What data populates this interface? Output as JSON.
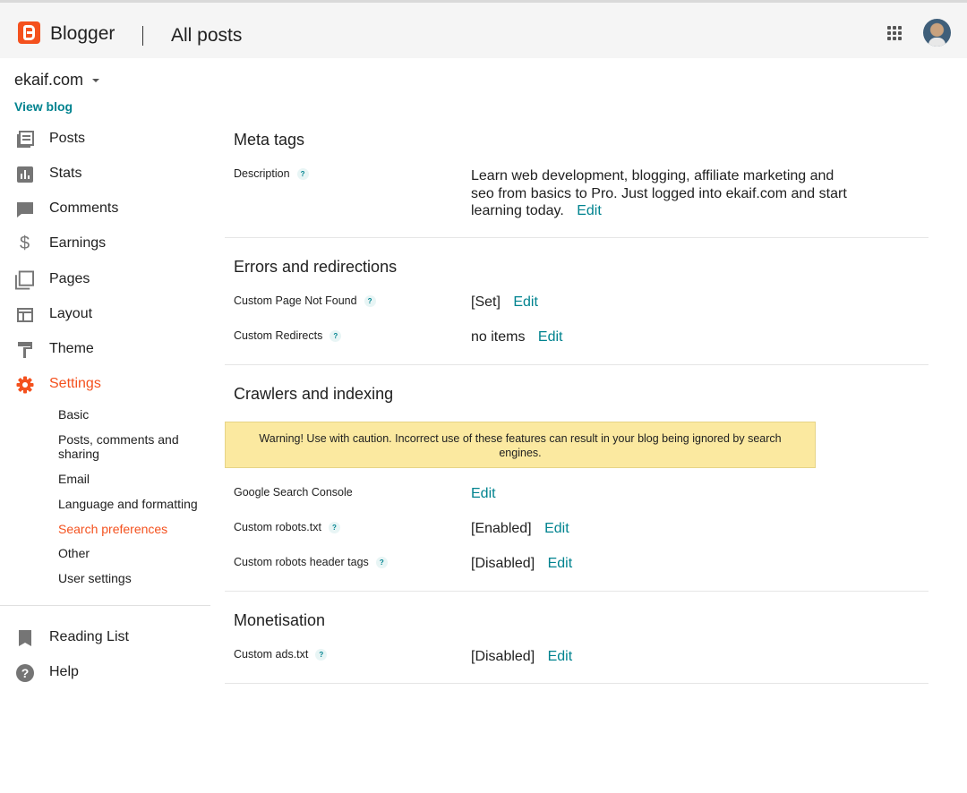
{
  "header": {
    "brand": "Blogger",
    "page_title": "All posts"
  },
  "sidebar": {
    "blog_name": "ekaif.com",
    "view_blog": "View blog",
    "items": [
      {
        "label": "Posts",
        "icon": "posts-icon"
      },
      {
        "label": "Stats",
        "icon": "stats-icon"
      },
      {
        "label": "Comments",
        "icon": "comments-icon"
      },
      {
        "label": "Earnings",
        "icon": "dollar-icon"
      },
      {
        "label": "Pages",
        "icon": "pages-icon"
      },
      {
        "label": "Layout",
        "icon": "layout-icon"
      },
      {
        "label": "Theme",
        "icon": "paint-roller-icon"
      },
      {
        "label": "Settings",
        "icon": "gear-icon",
        "active": true
      }
    ],
    "settings_sub": [
      {
        "label": "Basic"
      },
      {
        "label": "Posts, comments and sharing"
      },
      {
        "label": "Email"
      },
      {
        "label": "Language and formatting"
      },
      {
        "label": "Search preferences",
        "active": true
      },
      {
        "label": "Other"
      },
      {
        "label": "User settings"
      }
    ],
    "bottom_items": [
      {
        "label": "Reading List",
        "icon": "bookmark-icon"
      },
      {
        "label": "Help",
        "icon": "help-icon"
      }
    ]
  },
  "sections": {
    "meta_tags": {
      "title": "Meta tags",
      "description_label": "Description",
      "description_value": "Learn web development, blogging, affiliate marketing and seo from basics to Pro. Just logged into ekaif.com and start learning today.",
      "edit": "Edit"
    },
    "errors": {
      "title": "Errors and redirections",
      "not_found_label": "Custom Page Not Found",
      "not_found_value": "[Set]",
      "redirects_label": "Custom Redirects",
      "redirects_value": "no items",
      "edit": "Edit"
    },
    "crawlers": {
      "title": "Crawlers and indexing",
      "warning": "Warning! Use with caution. Incorrect use of these features can result in your blog being ignored by search engines.",
      "gsc_label": "Google Search Console",
      "robots_label": "Custom robots.txt",
      "robots_value": "[Enabled]",
      "header_tags_label": "Custom robots header tags",
      "header_tags_value": "[Disabled]",
      "edit": "Edit"
    },
    "monetisation": {
      "title": "Monetisation",
      "ads_label": "Custom ads.txt",
      "ads_value": "[Disabled]",
      "edit": "Edit"
    }
  },
  "help_mark": "?",
  "colors": {
    "accent": "#f4511e",
    "link": "#00838f",
    "warning_bg": "#fbe9a0"
  }
}
